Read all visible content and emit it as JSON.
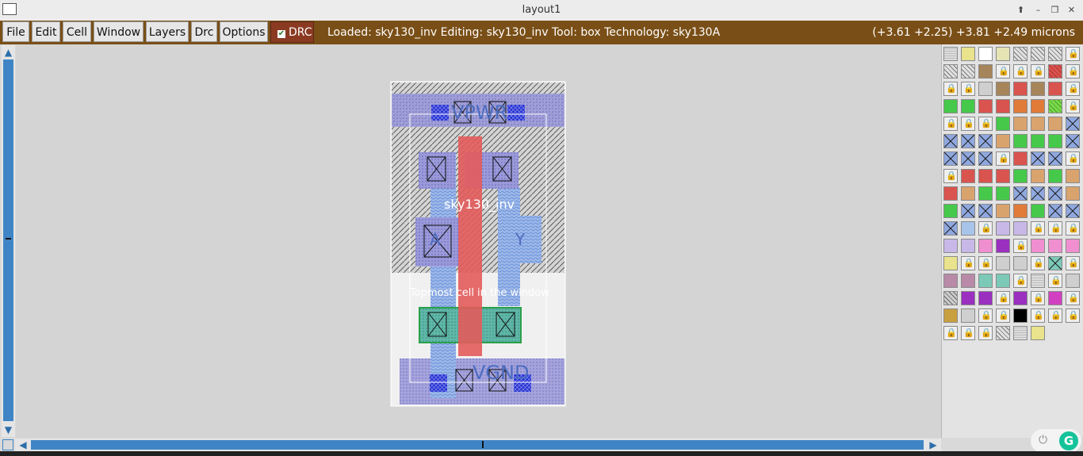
{
  "window": {
    "title": "layout1"
  },
  "menu": {
    "items": [
      "File",
      "Edit",
      "Cell",
      "Window",
      "Layers",
      "Drc",
      "Options"
    ],
    "drc_label": "DRC"
  },
  "status": {
    "text": "Loaded: sky130_inv Editing: sky130_inv Tool: box  Technology: sky130A",
    "coords": "(+3.61 +2.25) +3.81 +2.49 microns"
  },
  "layout": {
    "cell_name": "sky130_inv",
    "box_label": "Topmost cell in the window",
    "labels": {
      "vpwr": "VPWR",
      "vgnd": "VGND",
      "a": "A",
      "y": "Y"
    }
  },
  "colors": {
    "menubar": "#7a4f17",
    "drc": "#8b3a22",
    "scroll": "#3f85c6",
    "poly": "#e35b5b",
    "nwell": "#a9a9d6"
  },
  "palette_rows": [
    [
      "dots",
      "yellow",
      "outline",
      "pale-yellow",
      "hatch",
      "hatch",
      "hatch",
      "lock"
    ],
    [
      "hatch",
      "hatch",
      "brown",
      "lock",
      "lock",
      "lock",
      "red-diag",
      "lock"
    ],
    [
      "lock",
      "lock",
      "grey",
      "brown",
      "red",
      "brown",
      "red",
      "lock"
    ],
    [
      "green",
      "green",
      "red",
      "red",
      "orange",
      "orange",
      "green-diag",
      "lock"
    ],
    [
      "lock",
      "lock",
      "lock",
      "green",
      "tan",
      "tan",
      "tan",
      "blue-x"
    ],
    [
      "blue-x",
      "blue-x",
      "blue-x",
      "tan",
      "green",
      "green",
      "green",
      "blue-x"
    ],
    [
      "blue-x",
      "blue-x",
      "blue-x",
      "lock",
      "red",
      "blue-x",
      "blue-x",
      "lock"
    ],
    [
      "lock",
      "red",
      "red",
      "red",
      "green",
      "tan",
      "green",
      "tan"
    ],
    [
      "red",
      "tan",
      "green",
      "green",
      "blue-x",
      "blue-x",
      "blue-x",
      "tan"
    ],
    [
      "green",
      "blue-x",
      "blue-x",
      "tan",
      "orange",
      "green",
      "blue-x",
      "blue-x"
    ],
    [
      "blue-x",
      "light-blue",
      "lock",
      "lavender",
      "lavender",
      "lock",
      "lock",
      "lock"
    ],
    [
      "lavender",
      "lavender",
      "pink",
      "purple",
      "lock",
      "pink",
      "pink",
      "pink"
    ],
    [
      "yellow",
      "lock",
      "lock",
      "grey",
      "grey",
      "lock",
      "teal-x",
      "lock"
    ],
    [
      "mauve",
      "mauve",
      "teal",
      "teal",
      "lock",
      "dots",
      "lock",
      "grey"
    ],
    [
      "grey-diag",
      "purple",
      "purple",
      "lock",
      "purple",
      "lock",
      "magenta",
      "lock"
    ],
    [
      "gold",
      "grey",
      "lock",
      "lock",
      "black",
      "lock",
      "lock",
      "lock"
    ],
    [
      "lock",
      "lock",
      "lock",
      "hatch",
      "dots",
      "yellow"
    ]
  ]
}
